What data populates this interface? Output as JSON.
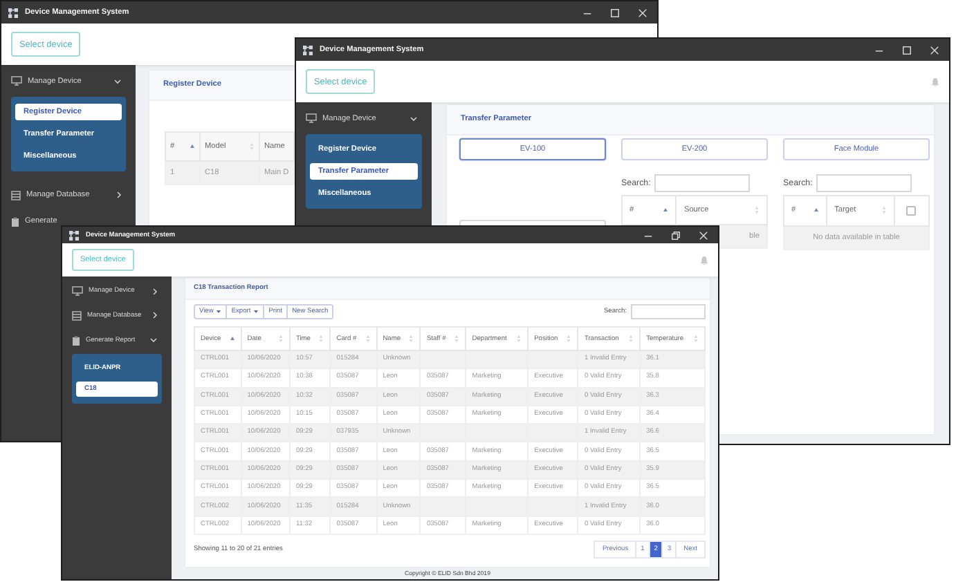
{
  "windows": [
    {
      "kind": "register",
      "title": "Device Management System",
      "maximized": false,
      "select_device": "Select device",
      "sidebar": [
        {
          "label": "Manage Device",
          "expanded": true,
          "children": [
            {
              "label": "Register Device",
              "selected": true
            },
            {
              "label": "Transfer Parameter",
              "selected": false
            },
            {
              "label": "Miscellaneous",
              "selected": false
            }
          ]
        },
        {
          "label": "Manage Database",
          "expanded": false
        },
        {
          "label": "Generate"
        }
      ],
      "panel": {
        "title": "Register Device",
        "table": {
          "columns": [
            {
              "label": "#",
              "sorted": true
            },
            {
              "label": "Model",
              "sorted": false
            },
            {
              "label": "Name"
            }
          ],
          "rows": [
            [
              "1",
              "C18",
              "Main D"
            ]
          ]
        }
      }
    },
    {
      "kind": "transfer",
      "title": "Device Management System",
      "maximized": false,
      "select_device": "Select device",
      "sidebar": [
        {
          "label": "Manage Device",
          "expanded": true,
          "children": [
            {
              "label": "Register Device",
              "selected": false
            },
            {
              "label": "Transfer Parameter",
              "selected": true
            },
            {
              "label": "Miscellaneous",
              "selected": false
            }
          ]
        }
      ],
      "panel": {
        "title": "Transfer Parameter",
        "sections": [
          {
            "button": {
              "label": "EV-100",
              "selected": true
            }
          },
          {
            "button": {
              "label": "EV-200",
              "selected": false
            },
            "search_label": "Search:",
            "table": {
              "columns": [
                {
                  "label": "#",
                  "sorted": true
                },
                {
                  "label": "Source",
                  "sorted": false
                }
              ],
              "empty_message": "ble"
            }
          },
          {
            "button": {
              "label": "Face Module",
              "selected": false
            },
            "search_label": "Search:",
            "table": {
              "columns": [
                {
                  "label": "#",
                  "sorted": true
                },
                {
                  "label": "Target",
                  "sorted": false
                },
                {
                  "kind": "checkbox",
                  "checked": false
                }
              ],
              "empty_message": "No data available in table"
            }
          }
        ]
      }
    },
    {
      "kind": "report",
      "title": "Device Management System",
      "maximized": true,
      "select_device": "Select device",
      "sidebar": [
        {
          "label": "Manage Device",
          "expanded": false
        },
        {
          "label": "Manage Database",
          "expanded": false
        },
        {
          "label": "Generate Report",
          "expanded": true,
          "children": [
            {
              "label": "ELID-ANPR",
              "selected": false
            },
            {
              "label": "C18",
              "selected": true
            }
          ]
        }
      ],
      "panel": {
        "title": "C18 Transaction Report",
        "toolbar": [
          {
            "label": "View",
            "kind": "dropdown"
          },
          {
            "label": "Export",
            "kind": "dropdown"
          },
          {
            "label": "Print",
            "kind": "button"
          },
          {
            "label": "New Search",
            "kind": "button"
          }
        ],
        "search_label": "Search:",
        "table": {
          "columns": [
            {
              "label": "Device",
              "sorted": true
            },
            {
              "label": "Date",
              "sorted": false
            },
            {
              "label": "Time",
              "sorted": false
            },
            {
              "label": "Card #",
              "sorted": false
            },
            {
              "label": "Name",
              "sorted": false
            },
            {
              "label": "Staff #",
              "sorted": false
            },
            {
              "label": "Department",
              "sorted": false
            },
            {
              "label": "Position",
              "sorted": false
            },
            {
              "label": "Transaction",
              "sorted": false
            },
            {
              "label": "Temperature",
              "sorted": false
            }
          ],
          "rows": [
            [
              "CTRL001",
              "10/06/2020",
              "10:57",
              "015284",
              "Unknown",
              null,
              null,
              null,
              "1 Invalid Entry",
              "36.1"
            ],
            [
              "CTRL001",
              "10/06/2020",
              "10:38",
              "035087",
              "Leon",
              "035087",
              "Marketing",
              "Executive",
              "0 Valid Entry",
              "35.8"
            ],
            [
              "CTRL001",
              "10/06/2020",
              "10:32",
              "035087",
              "Leon",
              "035087",
              "Marketing",
              "Executive",
              "0 Valid Entry",
              "36.3"
            ],
            [
              "CTRL001",
              "10/06/2020",
              "10:15",
              "035087",
              "Leon",
              "035087",
              "Marketing",
              "Executive",
              "0 Valid Entry",
              "36.4"
            ],
            [
              "CTRL001",
              "10/06/2020",
              "09:29",
              "037935",
              "Unknown",
              null,
              null,
              null,
              "1 Invalid Entry",
              "36.6"
            ],
            [
              "CTRL001",
              "10/06/2020",
              "09:29",
              "035087",
              "Leon",
              "035087",
              "Marketing",
              "Executive",
              "0 Valid Entry",
              "36.5"
            ],
            [
              "CTRL001",
              "10/06/2020",
              "09:29",
              "035087",
              "Leon",
              "035087",
              "Marketing",
              "Executive",
              "0 Valid Entry",
              "35.9"
            ],
            [
              "CTRL001",
              "10/06/2020",
              "09:29",
              "035087",
              "Leon",
              "035087",
              "Marketing",
              "Executive",
              "0 Valid Entry",
              "36.5"
            ],
            [
              "CTRL002",
              "10/06/2020",
              "11:35",
              "015284",
              "Unknown",
              null,
              null,
              null,
              "1 Invalid Entry",
              "36.0"
            ],
            [
              "CTRL002",
              "10/06/2020",
              "11:32",
              "035087",
              "Leon",
              "035087",
              "Marketing",
              "Executive",
              "0 Valid Entry",
              "36.0"
            ]
          ]
        },
        "info": "Showing 11 to 20 of 21 entries",
        "pagination": [
          {
            "label": "Previous",
            "selected": false
          },
          {
            "label": "1",
            "selected": false
          },
          {
            "label": "2",
            "selected": true
          },
          {
            "label": "3",
            "selected": false
          },
          {
            "label": "Next",
            "selected": false
          }
        ]
      },
      "footer": "Copyright © ELID Sdn Bhd 2019"
    }
  ]
}
